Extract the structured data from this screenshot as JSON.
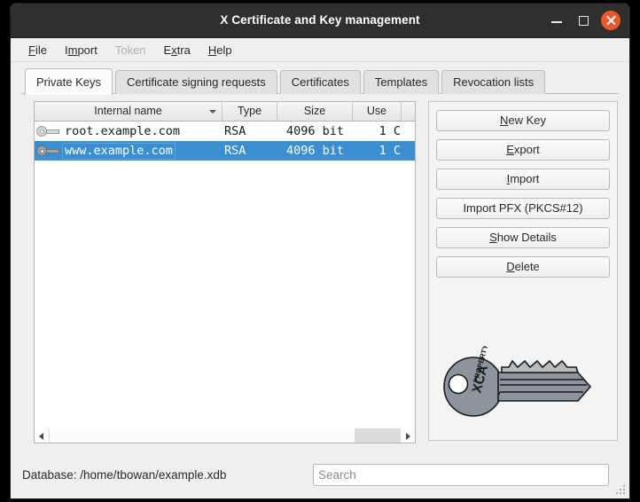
{
  "window": {
    "title": "X Certificate and Key management",
    "controls": {
      "minimize": "minimize-button",
      "maximize": "maximize-button",
      "close": "close-button"
    }
  },
  "menubar": {
    "items": [
      {
        "label": "File",
        "mnemonic_index": 0,
        "disabled": false
      },
      {
        "label": "Import",
        "mnemonic_index": 1,
        "disabled": false
      },
      {
        "label": "Token",
        "mnemonic_index": -1,
        "disabled": true
      },
      {
        "label": "Extra",
        "mnemonic_index": 1,
        "disabled": false
      },
      {
        "label": "Help",
        "mnemonic_index": 0,
        "disabled": false
      }
    ]
  },
  "tabs": {
    "active_index": 0,
    "items": [
      {
        "label": "Private Keys"
      },
      {
        "label": "Certificate signing requests"
      },
      {
        "label": "Certificates"
      },
      {
        "label": "Templates"
      },
      {
        "label": "Revocation lists"
      }
    ]
  },
  "table": {
    "columns": [
      {
        "label": "Internal name",
        "sort": "descending"
      },
      {
        "label": "Type",
        "sort": "none"
      },
      {
        "label": "Size",
        "sort": "none"
      },
      {
        "label": "Use",
        "sort": "none"
      }
    ],
    "rows": [
      {
        "icon": "key-icon",
        "name": "root.example.com",
        "type": "RSA",
        "size": "4096 bit",
        "use": "1 C",
        "selected": false
      },
      {
        "icon": "key-icon",
        "name": "www.example.com",
        "type": "RSA",
        "size": "4096 bit",
        "use": "1 C",
        "selected": true
      }
    ]
  },
  "side_panel": {
    "buttons": [
      {
        "label": "New Key",
        "mnemonic_index": 0
      },
      {
        "label": "Export",
        "mnemonic_index": 0
      },
      {
        "label": "Import",
        "mnemonic_index": 0
      },
      {
        "label": "Import PFX (PKCS#12)",
        "mnemonic_index": -1
      },
      {
        "label": "Show Details",
        "mnemonic_index": 0
      },
      {
        "label": "Delete",
        "mnemonic_index": 0
      }
    ],
    "logo": {
      "name": "xca-key-logo",
      "engraving_line1": "PROPERTY OF",
      "engraving_line2": "XCA"
    }
  },
  "statusbar": {
    "database_label": "Database: /home/tbowan/example.xdb",
    "search": {
      "value": "",
      "placeholder": "Search"
    }
  },
  "colors": {
    "titlebar_bg": "#302f2d",
    "close_button": "#e9592b",
    "selection": "#3a8fd2",
    "window_bg": "#f0efee"
  }
}
